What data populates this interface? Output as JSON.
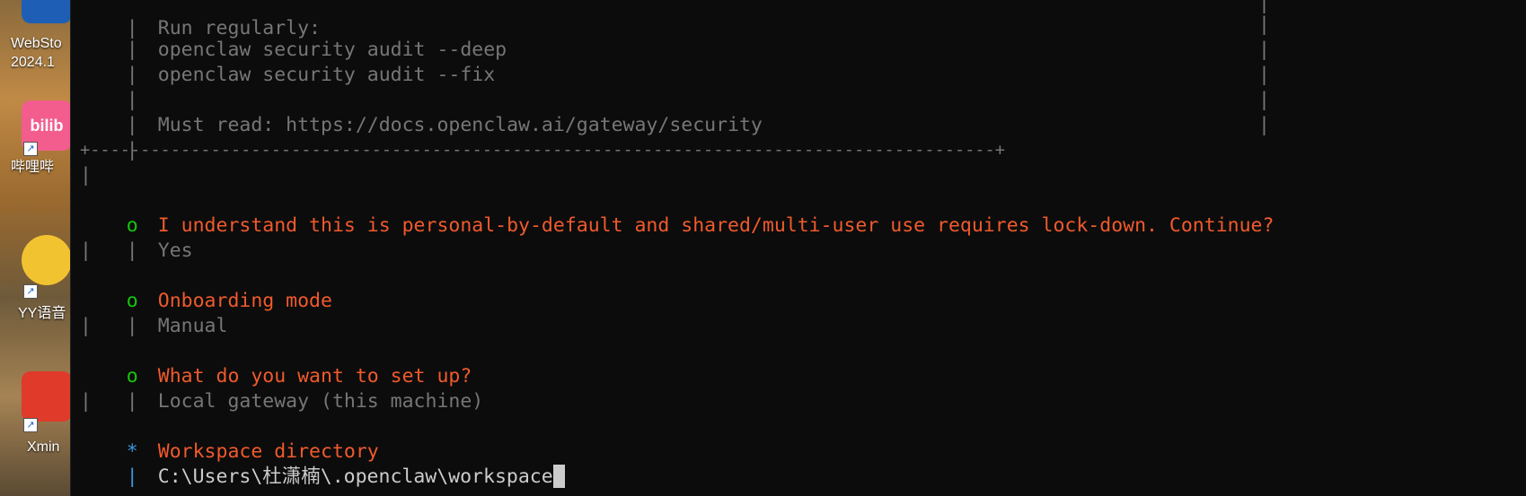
{
  "desktop": {
    "icons": [
      {
        "label": "WebSto\n2024.1",
        "color": "#1e5fb5"
      },
      {
        "label": "哔哩哔",
        "color": "#f25d8e",
        "img_text": "bilib"
      },
      {
        "label": "YY语音",
        "color": "#f2c331"
      },
      {
        "label": "Xmin",
        "color": "#e03a2a"
      }
    ]
  },
  "terminal": {
    "box_top_text": "Run regularly:",
    "box_lines": [
      "openclaw security audit --deep",
      "openclaw security audit --fix"
    ],
    "must_read": "Must read: https://docs.openclaw.ai/gateway/security",
    "box_bottom": "+------------------------------------------------------------------------------------------+",
    "bar": "|",
    "marker_done": "o",
    "marker_active": "*",
    "steps": [
      {
        "question": "I understand this is personal-by-default and shared/multi-user use requires lock-down. Continue?",
        "answer": "Yes"
      },
      {
        "question": "Onboarding mode",
        "answer": "Manual"
      },
      {
        "question": "What do you want to set up?",
        "answer": "Local gateway (this machine)"
      }
    ],
    "active_question": "Workspace directory",
    "active_input_value": "C:\\Users\\杜潇楠\\.openclaw\\workspace",
    "end_marker": "—"
  },
  "colors": {
    "background": "#0c0c0c",
    "dim": "#767676",
    "orange": "#f05a2c",
    "green": "#16c60c",
    "cyan": "#3a96dd",
    "bright": "#cccccc"
  }
}
